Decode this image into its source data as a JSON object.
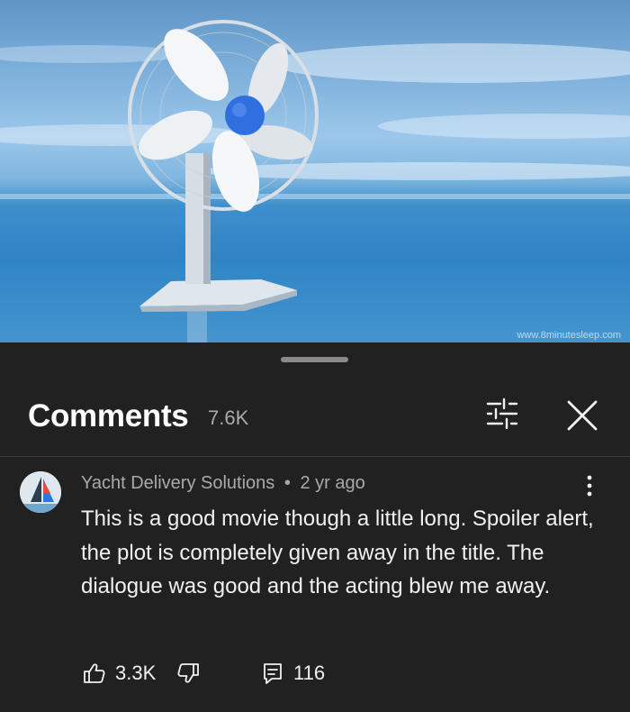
{
  "video": {
    "watermark": "www.8minutesleep.com"
  },
  "comments_panel": {
    "title": "Comments",
    "count": "7.6K",
    "filter_icon": "sliders-icon",
    "close_icon": "close-icon"
  },
  "comment": {
    "author": "Yacht Delivery Solutions",
    "separator": "•",
    "time": "2 yr ago",
    "text": "This is a good movie though a little long. Spoiler alert, the plot is completely given away in the title. The dialogue was good and the acting blew me away.",
    "likes": "3.3K",
    "replies": "116",
    "like_icon": "thumbs-up-icon",
    "dislike_icon": "thumbs-down-icon",
    "reply_icon": "reply-icon",
    "more_icon": "more-vertical-icon"
  },
  "colors": {
    "background": "#212121",
    "text": "#f1f1f1",
    "secondary_text": "#aaaaaa",
    "fan_hub": "#2f6fe0"
  }
}
